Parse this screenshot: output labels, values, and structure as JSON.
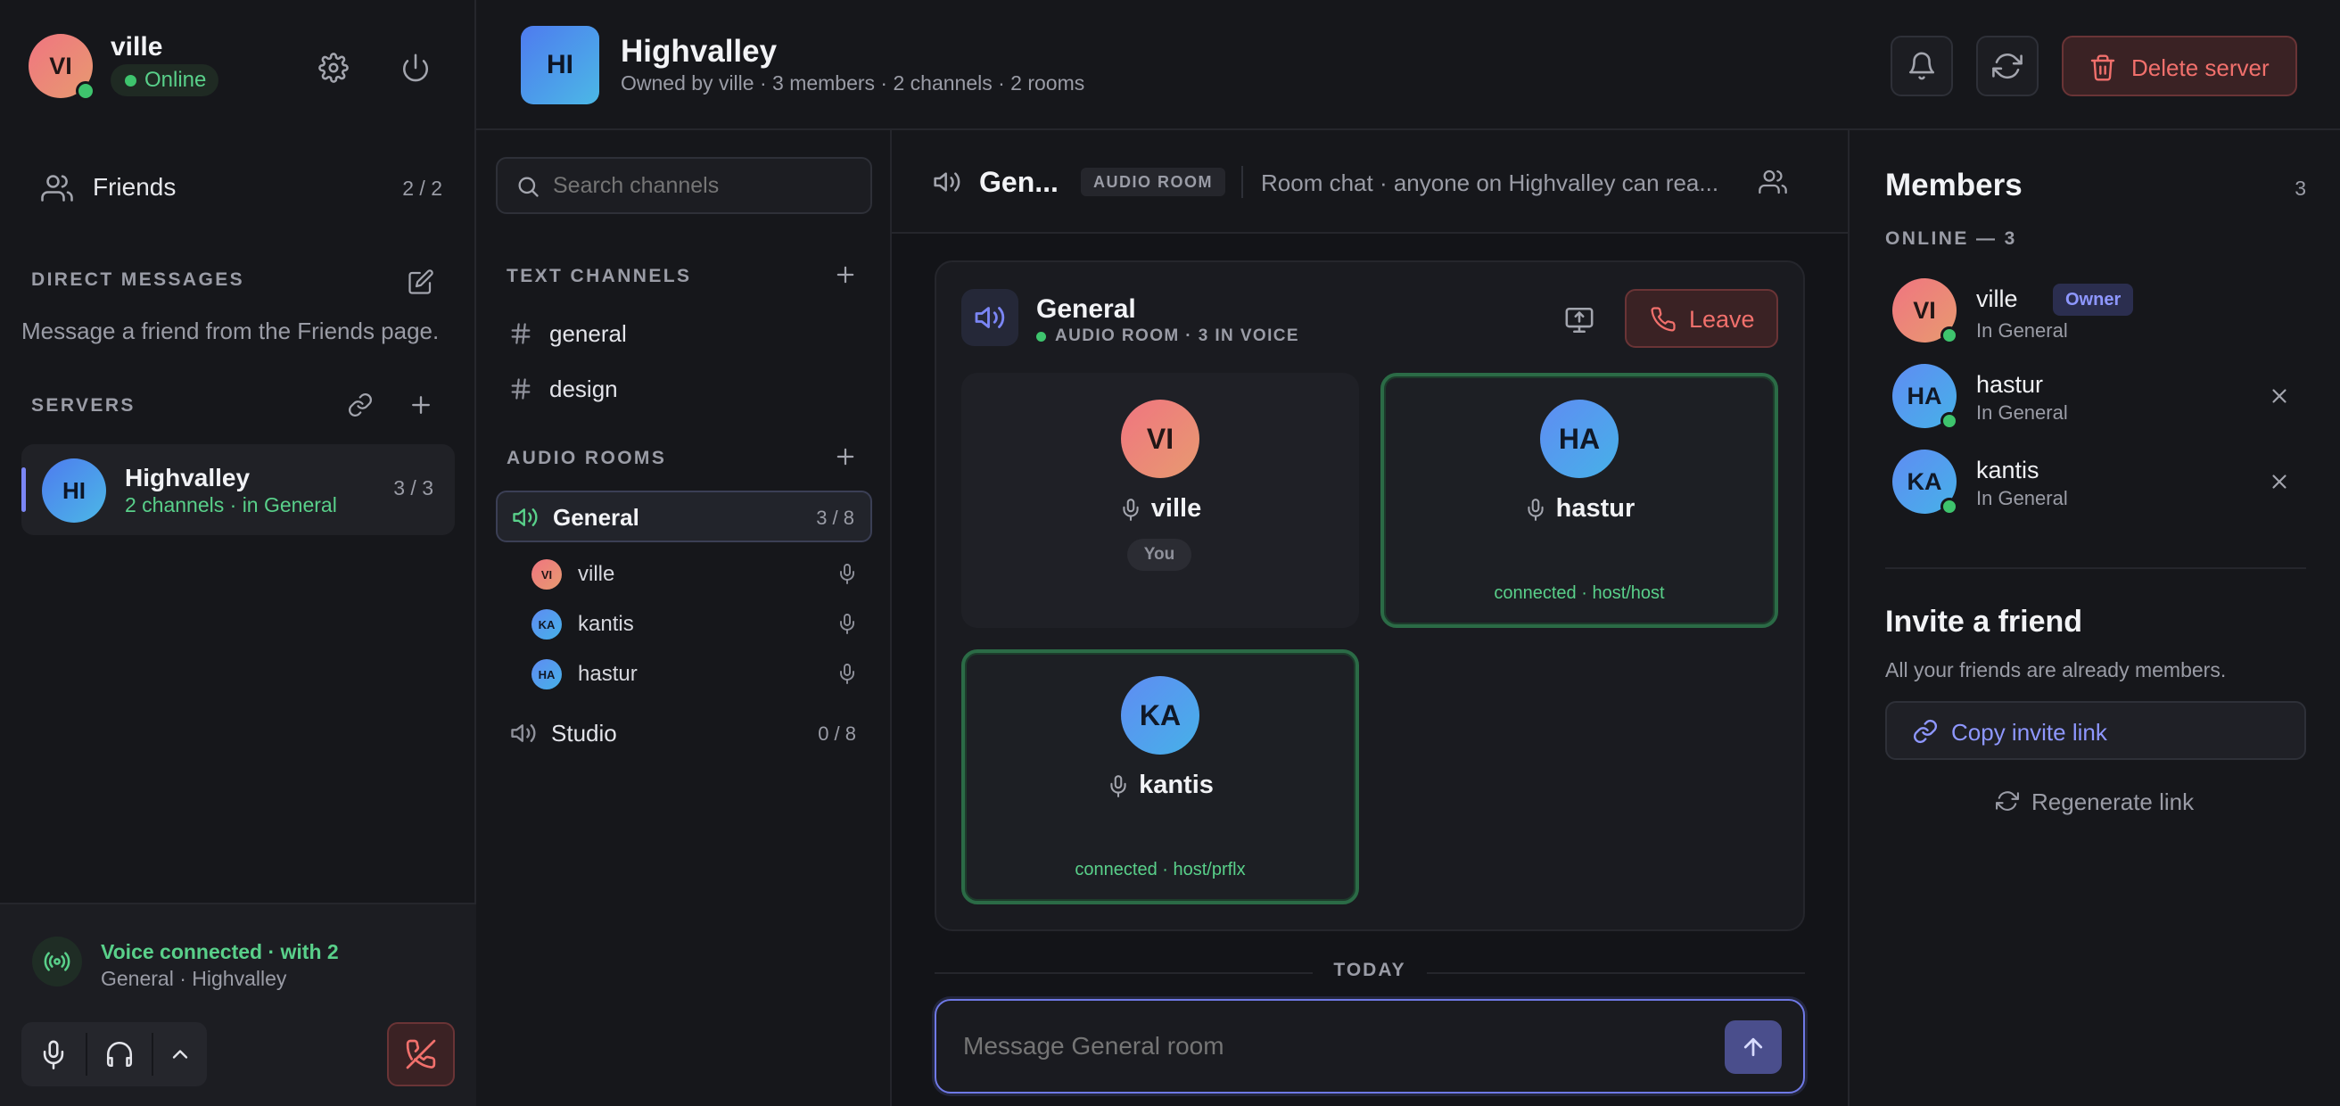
{
  "user": {
    "initials": "VI",
    "name": "ville",
    "status": "Online"
  },
  "sidebar": {
    "friends": {
      "label": "Friends",
      "count": "2 / 2"
    },
    "dm_title": "DIRECT MESSAGES",
    "dm_hint": "Message a friend from the Friends page.",
    "servers_title": "SERVERS",
    "servers": [
      {
        "initials": "HI",
        "name": "Highvalley",
        "sub": "2 channels · in General",
        "count": "3 / 3"
      }
    ]
  },
  "voice_bar": {
    "title": "Voice connected · with 2",
    "sub": "General · Highvalley"
  },
  "server": {
    "initials": "HI",
    "name": "Highvalley",
    "sub": "Owned by ville · 3 members · 2 channels · 2 rooms",
    "delete_label": "Delete server"
  },
  "channels": {
    "search_placeholder": "Search channels",
    "text_title": "TEXT CHANNELS",
    "text": [
      "general",
      "design"
    ],
    "audio_title": "AUDIO ROOMS",
    "rooms": [
      {
        "name": "General",
        "count": "3 / 8",
        "participants": [
          {
            "initials": "VI",
            "name": "ville"
          },
          {
            "initials": "KA",
            "name": "kantis"
          },
          {
            "initials": "HA",
            "name": "hastur"
          }
        ]
      },
      {
        "name": "Studio",
        "count": "0 / 8",
        "participants": []
      }
    ]
  },
  "room_header": {
    "name": "Gen...",
    "badge": "AUDIO ROOM",
    "description": "Room chat · anyone on Highvalley can rea..."
  },
  "voice_panel": {
    "name": "General",
    "sub": "AUDIO ROOM · 3 IN VOICE",
    "leave_label": "Leave",
    "tiles": [
      {
        "initials": "VI",
        "name": "ville",
        "tag": "You",
        "status": ""
      },
      {
        "initials": "HA",
        "name": "hastur",
        "tag": "",
        "status": "connected · host/host"
      },
      {
        "initials": "KA",
        "name": "kantis",
        "tag": "",
        "status": "connected · host/prflx"
      }
    ]
  },
  "chat": {
    "divider": "TODAY",
    "placeholder": "Message General room"
  },
  "members": {
    "title": "Members",
    "count": "3",
    "online_title": "ONLINE — 3",
    "list": [
      {
        "initials": "VI",
        "name": "ville",
        "badge": "Owner",
        "sub": "In General"
      },
      {
        "initials": "HA",
        "name": "hastur",
        "badge": "",
        "sub": "In General"
      },
      {
        "initials": "KA",
        "name": "kantis",
        "badge": "",
        "sub": "In General"
      }
    ],
    "invite_title": "Invite a friend",
    "invite_sub": "All your friends are already members.",
    "copy_label": "Copy invite link",
    "regen_label": "Regenerate link"
  },
  "colors": {
    "accent": "#7b86f5",
    "online": "#3ec46d",
    "danger": "#f1706c",
    "voice": "#59d08a"
  }
}
